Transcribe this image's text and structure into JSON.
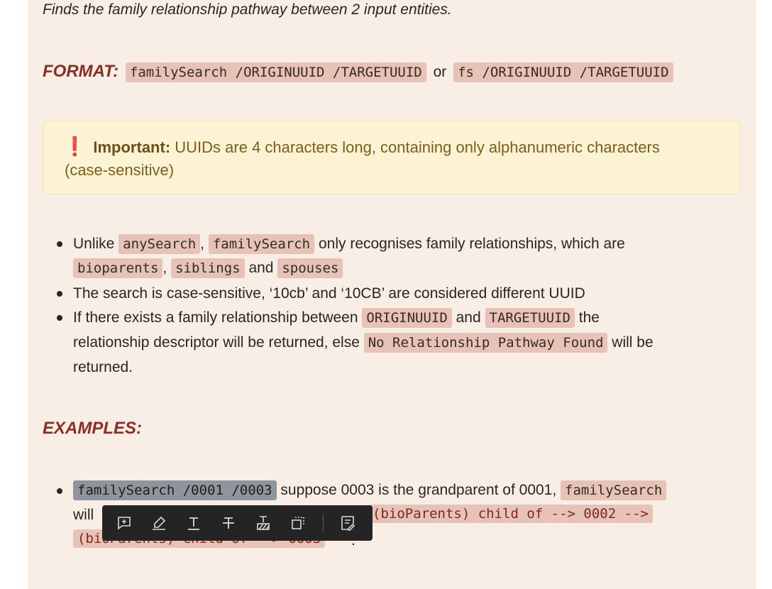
{
  "description": "Finds the family relationship pathway between 2 input entities.",
  "format": {
    "heading": "FORMAT:",
    "code1": "familySearch /ORIGINUUID /TARGETUUID",
    "or": "or",
    "code2": "fs /ORIGINUUID /TARGETUUID"
  },
  "important": {
    "label": "Important:",
    "text1": "UUIDs are 4 characters long, containing only alphanumeric characters",
    "text2": "(case-sensitive)"
  },
  "bullets": {
    "b1_unlike": "Unlike",
    "b1_code1": "anySearch",
    "b1_comma1": ",",
    "b1_code2": "familySearch",
    "b1_text": "only recognises family relationships, which are",
    "b1_code3": "bioparents",
    "b1_comma2": ",",
    "b1_code4": "siblings",
    "b1_and": "and",
    "b1_code5": "spouses",
    "b2_text": "The search is case-sensitive, ‘10cb’ and ‘10CB’ are considered different UUID",
    "b3_text1": "If there exists a family relationship between",
    "b3_code1": "ORIGINUUID",
    "b3_and": "and",
    "b3_code2": "TARGETUUID",
    "b3_the": "the",
    "b3_text2": "relationship descriptor will be returned, else",
    "b3_code3": "No Relationship Pathway Found",
    "b3_text3": "will be",
    "b3_text4": "returned."
  },
  "examples": {
    "heading": "EXAMPLES:",
    "code_selected": "familySearch /0001 /0003",
    "text1": "suppose 0003 is the grandparent of 0001,",
    "code2": "familySearch",
    "will": "will",
    "code3_visible": "(bioParents) child of --> 0002 -->",
    "code4": "(bioParents) child of --> 0003",
    "period": "."
  },
  "toolbar": {
    "icons": [
      "add-comment-icon",
      "highlight-icon",
      "text-color-icon",
      "strikethrough-icon",
      "highlight-text-icon",
      "copy-icon",
      "edit-note-icon"
    ]
  }
}
